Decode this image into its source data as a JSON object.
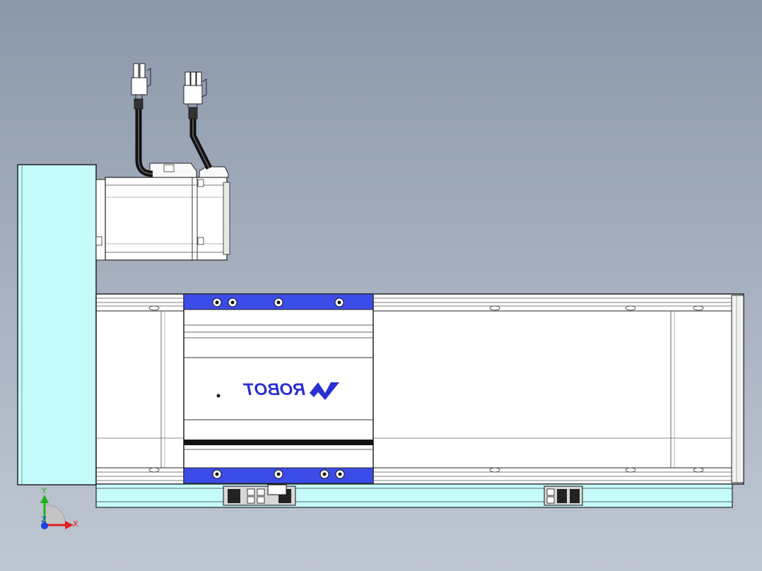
{
  "logo": {
    "text": "ROBOT"
  },
  "axes": {
    "x_label": "X",
    "y_label": "Y",
    "z_label": "Z"
  },
  "colors": {
    "background": "#9aa5b5",
    "mounting_plate": "#c6fbfb",
    "carriage_accent": "#3c4ce8",
    "logo": "#2a2fd0",
    "x_axis": "#e02020",
    "y_axis": "#20b020",
    "z_axis": "#2040e0"
  },
  "icons": [
    "cable-connector-icon",
    "screw-icon",
    "triad-axis-icon"
  ]
}
